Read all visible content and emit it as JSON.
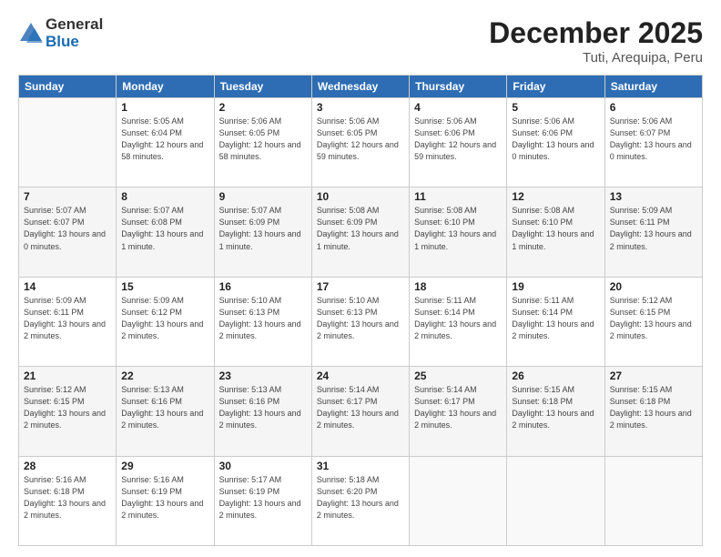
{
  "header": {
    "logo_general": "General",
    "logo_blue": "Blue",
    "month_title": "December 2025",
    "location": "Tuti, Arequipa, Peru"
  },
  "weekdays": [
    "Sunday",
    "Monday",
    "Tuesday",
    "Wednesday",
    "Thursday",
    "Friday",
    "Saturday"
  ],
  "weeks": [
    [
      {
        "day": "",
        "sunrise": "",
        "sunset": "",
        "daylight": ""
      },
      {
        "day": "1",
        "sunrise": "Sunrise: 5:05 AM",
        "sunset": "Sunset: 6:04 PM",
        "daylight": "Daylight: 12 hours and 58 minutes."
      },
      {
        "day": "2",
        "sunrise": "Sunrise: 5:06 AM",
        "sunset": "Sunset: 6:05 PM",
        "daylight": "Daylight: 12 hours and 58 minutes."
      },
      {
        "day": "3",
        "sunrise": "Sunrise: 5:06 AM",
        "sunset": "Sunset: 6:05 PM",
        "daylight": "Daylight: 12 hours and 59 minutes."
      },
      {
        "day": "4",
        "sunrise": "Sunrise: 5:06 AM",
        "sunset": "Sunset: 6:06 PM",
        "daylight": "Daylight: 12 hours and 59 minutes."
      },
      {
        "day": "5",
        "sunrise": "Sunrise: 5:06 AM",
        "sunset": "Sunset: 6:06 PM",
        "daylight": "Daylight: 13 hours and 0 minutes."
      },
      {
        "day": "6",
        "sunrise": "Sunrise: 5:06 AM",
        "sunset": "Sunset: 6:07 PM",
        "daylight": "Daylight: 13 hours and 0 minutes."
      }
    ],
    [
      {
        "day": "7",
        "sunrise": "Sunrise: 5:07 AM",
        "sunset": "Sunset: 6:07 PM",
        "daylight": "Daylight: 13 hours and 0 minutes."
      },
      {
        "day": "8",
        "sunrise": "Sunrise: 5:07 AM",
        "sunset": "Sunset: 6:08 PM",
        "daylight": "Daylight: 13 hours and 1 minute."
      },
      {
        "day": "9",
        "sunrise": "Sunrise: 5:07 AM",
        "sunset": "Sunset: 6:09 PM",
        "daylight": "Daylight: 13 hours and 1 minute."
      },
      {
        "day": "10",
        "sunrise": "Sunrise: 5:08 AM",
        "sunset": "Sunset: 6:09 PM",
        "daylight": "Daylight: 13 hours and 1 minute."
      },
      {
        "day": "11",
        "sunrise": "Sunrise: 5:08 AM",
        "sunset": "Sunset: 6:10 PM",
        "daylight": "Daylight: 13 hours and 1 minute."
      },
      {
        "day": "12",
        "sunrise": "Sunrise: 5:08 AM",
        "sunset": "Sunset: 6:10 PM",
        "daylight": "Daylight: 13 hours and 1 minute."
      },
      {
        "day": "13",
        "sunrise": "Sunrise: 5:09 AM",
        "sunset": "Sunset: 6:11 PM",
        "daylight": "Daylight: 13 hours and 2 minutes."
      }
    ],
    [
      {
        "day": "14",
        "sunrise": "Sunrise: 5:09 AM",
        "sunset": "Sunset: 6:11 PM",
        "daylight": "Daylight: 13 hours and 2 minutes."
      },
      {
        "day": "15",
        "sunrise": "Sunrise: 5:09 AM",
        "sunset": "Sunset: 6:12 PM",
        "daylight": "Daylight: 13 hours and 2 minutes."
      },
      {
        "day": "16",
        "sunrise": "Sunrise: 5:10 AM",
        "sunset": "Sunset: 6:13 PM",
        "daylight": "Daylight: 13 hours and 2 minutes."
      },
      {
        "day": "17",
        "sunrise": "Sunrise: 5:10 AM",
        "sunset": "Sunset: 6:13 PM",
        "daylight": "Daylight: 13 hours and 2 minutes."
      },
      {
        "day": "18",
        "sunrise": "Sunrise: 5:11 AM",
        "sunset": "Sunset: 6:14 PM",
        "daylight": "Daylight: 13 hours and 2 minutes."
      },
      {
        "day": "19",
        "sunrise": "Sunrise: 5:11 AM",
        "sunset": "Sunset: 6:14 PM",
        "daylight": "Daylight: 13 hours and 2 minutes."
      },
      {
        "day": "20",
        "sunrise": "Sunrise: 5:12 AM",
        "sunset": "Sunset: 6:15 PM",
        "daylight": "Daylight: 13 hours and 2 minutes."
      }
    ],
    [
      {
        "day": "21",
        "sunrise": "Sunrise: 5:12 AM",
        "sunset": "Sunset: 6:15 PM",
        "daylight": "Daylight: 13 hours and 2 minutes."
      },
      {
        "day": "22",
        "sunrise": "Sunrise: 5:13 AM",
        "sunset": "Sunset: 6:16 PM",
        "daylight": "Daylight: 13 hours and 2 minutes."
      },
      {
        "day": "23",
        "sunrise": "Sunrise: 5:13 AM",
        "sunset": "Sunset: 6:16 PM",
        "daylight": "Daylight: 13 hours and 2 minutes."
      },
      {
        "day": "24",
        "sunrise": "Sunrise: 5:14 AM",
        "sunset": "Sunset: 6:17 PM",
        "daylight": "Daylight: 13 hours and 2 minutes."
      },
      {
        "day": "25",
        "sunrise": "Sunrise: 5:14 AM",
        "sunset": "Sunset: 6:17 PM",
        "daylight": "Daylight: 13 hours and 2 minutes."
      },
      {
        "day": "26",
        "sunrise": "Sunrise: 5:15 AM",
        "sunset": "Sunset: 6:18 PM",
        "daylight": "Daylight: 13 hours and 2 minutes."
      },
      {
        "day": "27",
        "sunrise": "Sunrise: 5:15 AM",
        "sunset": "Sunset: 6:18 PM",
        "daylight": "Daylight: 13 hours and 2 minutes."
      }
    ],
    [
      {
        "day": "28",
        "sunrise": "Sunrise: 5:16 AM",
        "sunset": "Sunset: 6:18 PM",
        "daylight": "Daylight: 13 hours and 2 minutes."
      },
      {
        "day": "29",
        "sunrise": "Sunrise: 5:16 AM",
        "sunset": "Sunset: 6:19 PM",
        "daylight": "Daylight: 13 hours and 2 minutes."
      },
      {
        "day": "30",
        "sunrise": "Sunrise: 5:17 AM",
        "sunset": "Sunset: 6:19 PM",
        "daylight": "Daylight: 13 hours and 2 minutes."
      },
      {
        "day": "31",
        "sunrise": "Sunrise: 5:18 AM",
        "sunset": "Sunset: 6:20 PM",
        "daylight": "Daylight: 13 hours and 2 minutes."
      },
      {
        "day": "",
        "sunrise": "",
        "sunset": "",
        "daylight": ""
      },
      {
        "day": "",
        "sunrise": "",
        "sunset": "",
        "daylight": ""
      },
      {
        "day": "",
        "sunrise": "",
        "sunset": "",
        "daylight": ""
      }
    ]
  ]
}
